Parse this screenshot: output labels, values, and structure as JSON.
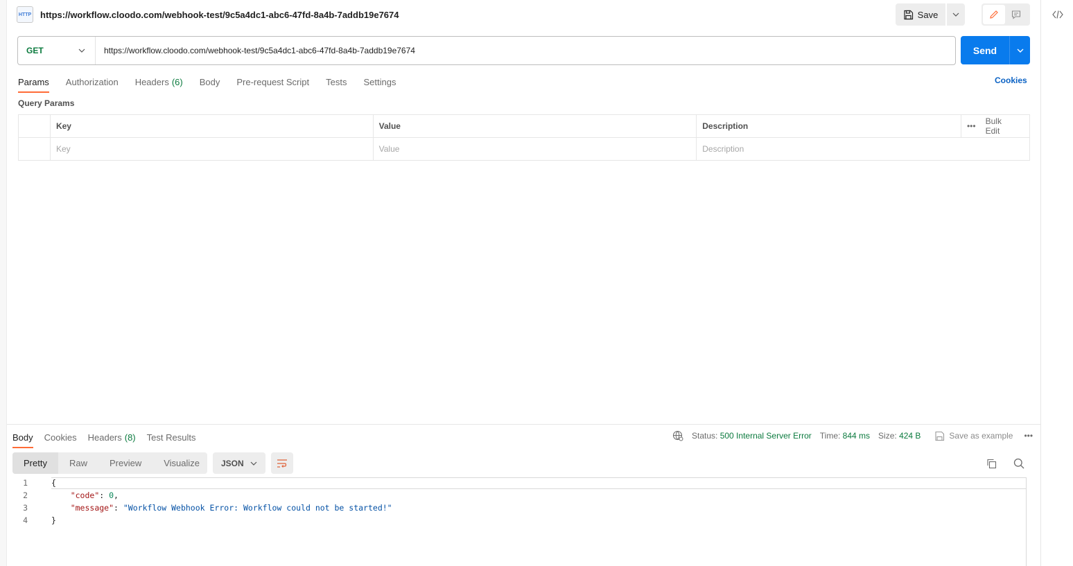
{
  "header": {
    "icon_text": "HTTP",
    "title": "https://workflow.cloodo.com/webhook-test/9c5a4dc1-abc6-47fd-8a4b-7addb19e7674",
    "save_label": "Save"
  },
  "request": {
    "method": "GET",
    "url": "https://workflow.cloodo.com/webhook-test/9c5a4dc1-abc6-47fd-8a4b-7addb19e7674",
    "send_label": "Send"
  },
  "request_tabs": [
    {
      "label": "Params",
      "count": ""
    },
    {
      "label": "Authorization",
      "count": ""
    },
    {
      "label": "Headers",
      "count": "(6)"
    },
    {
      "label": "Body",
      "count": ""
    },
    {
      "label": "Pre-request Script",
      "count": ""
    },
    {
      "label": "Tests",
      "count": ""
    },
    {
      "label": "Settings",
      "count": ""
    }
  ],
  "cookies_link": "Cookies",
  "query_params": {
    "title": "Query Params",
    "columns": [
      "Key",
      "Value",
      "Description"
    ],
    "bulk_edit": "Bulk Edit",
    "placeholders": [
      "Key",
      "Value",
      "Description"
    ]
  },
  "response": {
    "tabs": [
      {
        "label": "Body",
        "count": ""
      },
      {
        "label": "Cookies",
        "count": ""
      },
      {
        "label": "Headers",
        "count": "(8)"
      },
      {
        "label": "Test Results",
        "count": ""
      }
    ],
    "status_label": "Status:",
    "status_value": "500 Internal Server Error",
    "time_label": "Time:",
    "time_value": "844 ms",
    "size_label": "Size:",
    "size_value": "424 B",
    "save_example": "Save as example",
    "views": [
      "Pretty",
      "Raw",
      "Preview",
      "Visualize"
    ],
    "format": "JSON",
    "lines": [
      {
        "n": "1",
        "text": "{"
      },
      {
        "n": "2",
        "key": "\"code\"",
        "sep": ": ",
        "num": "0",
        "tail": ","
      },
      {
        "n": "3",
        "key": "\"message\"",
        "sep": ": ",
        "str": "\"Workflow Webhook Error: Workflow could not be started!\""
      },
      {
        "n": "4",
        "text": "}"
      }
    ]
  },
  "colors": {
    "accent": "#ff6c37",
    "send": "#097bed",
    "success_green": "#0b7a3e",
    "link_blue": "#0b62c4"
  }
}
